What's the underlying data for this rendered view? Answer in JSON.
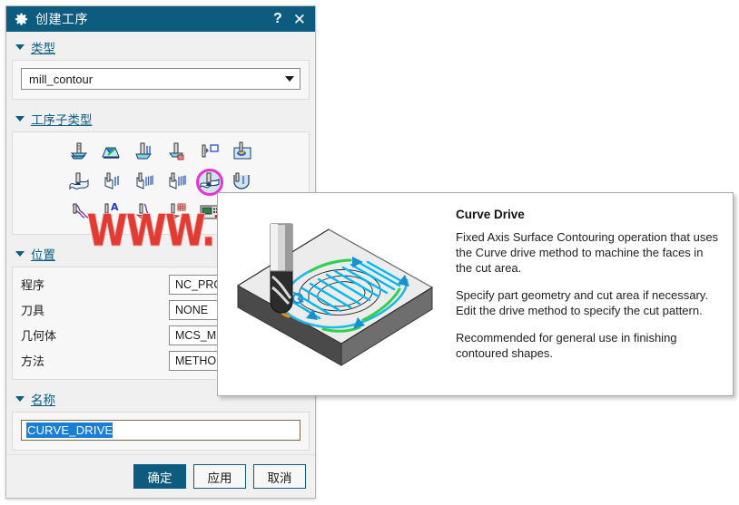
{
  "dialog": {
    "title": "创建工序",
    "title_icon": "gear-icon",
    "help_label": "?",
    "close_label": "✕",
    "sections": {
      "type": {
        "header": "类型",
        "combo_value": "mill_contour"
      },
      "subtype": {
        "header": "工序子类型",
        "selected_index": 10,
        "icons": [
          "cavity-mill-icon",
          "plunge-mill-icon",
          "corner-rough-icon",
          "rest-mill-icon",
          "profile-3d-icon",
          "zlevel-profile-icon",
          "fixed-contour-icon",
          "contour-area-icon",
          "contour-area-nonsteep-icon",
          "contour-area-steep-icon",
          "curve-drive-icon",
          "flowcut-single-icon",
          "streamline-icon",
          "contour-text-icon",
          "solid-profile-3d-icon",
          "profile-3d-curve-icon",
          "mill-control-icon",
          "mill-user-icon"
        ]
      },
      "location": {
        "header": "位置",
        "rows": [
          {
            "label": "程序",
            "value": "NC_PROGRAM"
          },
          {
            "label": "刀具",
            "value": "NONE"
          },
          {
            "label": "几何体",
            "value": "MCS_MILL"
          },
          {
            "label": "方法",
            "value": "METHOD"
          }
        ]
      },
      "name": {
        "header": "名称",
        "value": "CURVE_DRIVE"
      }
    },
    "footer": {
      "ok_label": "确定",
      "apply_label": "应用",
      "cancel_label": "取消"
    }
  },
  "tooltip": {
    "title": "Curve Drive",
    "paragraphs": [
      "Fixed Axis Surface Contouring operation that uses the Curve drive method to machine the faces in the cut area.",
      "Specify part geometry and cut area if necessary. Edit the drive method to specify the cut pattern.",
      "Recommended for general use in finishing contoured shapes."
    ],
    "image_name": "curve-drive-illustration"
  },
  "watermark": {
    "text": "WWW.UGNX.NET"
  },
  "colors": {
    "titlebar": "#0d5c80",
    "accent": "#0d5c80",
    "selection_ring": "#e831d8",
    "text_selection": "#1a7fd4",
    "watermark": "#e23b34",
    "toolpath": "#00b8f0"
  }
}
